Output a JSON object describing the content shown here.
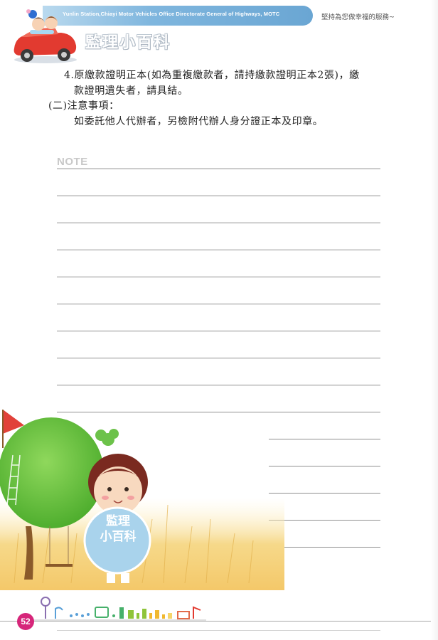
{
  "header": {
    "english_line": "Yunlin Station,Chiayi Motor Vehicles Office Directorate General of Highways, MOTC",
    "slogan": "堅持為您做幸福的服務~",
    "section_title": "監理小百科"
  },
  "content": {
    "item4_line1": "4.原繳款證明正本(如為重複繳款者，請持繳款證明正本2張)，繳",
    "item4_line2": "款證明遺失者，請具結。",
    "section2_heading": "(二)注意事項：",
    "section2_body": "如委託他人代辦者，另檢附代辦人身分證正本及印章。"
  },
  "note": {
    "label": "NOTE"
  },
  "badge": {
    "line1": "監理",
    "line2": "小百科"
  },
  "footer": {
    "page_number": "52"
  },
  "colors": {
    "header_band": "#7fb6de",
    "rule": "#8f8f8f",
    "badge": "#a9d3ec",
    "page_number_bg": "#d6267a",
    "tree_green": "#5fbf3a"
  }
}
